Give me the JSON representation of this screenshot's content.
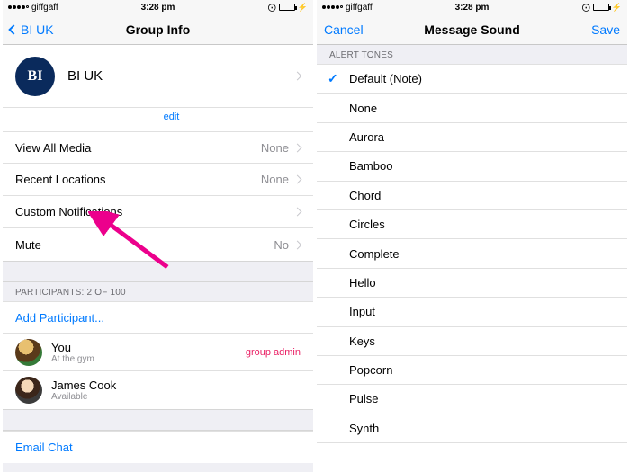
{
  "status": {
    "carrier": "giffgaff",
    "time": "3:28 pm"
  },
  "left": {
    "nav": {
      "back": "BI UK",
      "title": "Group Info"
    },
    "group": {
      "avatar": "BI",
      "name": "BI UK",
      "edit": "edit"
    },
    "rows": {
      "media": {
        "label": "View All Media",
        "value": "None"
      },
      "recent": {
        "label": "Recent Locations",
        "value": "None"
      },
      "custom": {
        "label": "Custom Notifications",
        "value": ""
      },
      "mute": {
        "label": "Mute",
        "value": "No"
      }
    },
    "participants_header": "Participants: 2 of 100",
    "add_participant": "Add Participant...",
    "participants": [
      {
        "name": "You",
        "sub": "At the gym",
        "admin": "group admin"
      },
      {
        "name": "James Cook",
        "sub": "Available",
        "admin": ""
      }
    ],
    "email_chat": "Email Chat"
  },
  "right": {
    "nav": {
      "cancel": "Cancel",
      "title": "Message Sound",
      "save": "Save"
    },
    "section": "Alert Tones",
    "selected_index": 0,
    "tones": [
      "Default (Note)",
      "None",
      "Aurora",
      "Bamboo",
      "Chord",
      "Circles",
      "Complete",
      "Hello",
      "Input",
      "Keys",
      "Popcorn",
      "Pulse",
      "Synth"
    ]
  }
}
